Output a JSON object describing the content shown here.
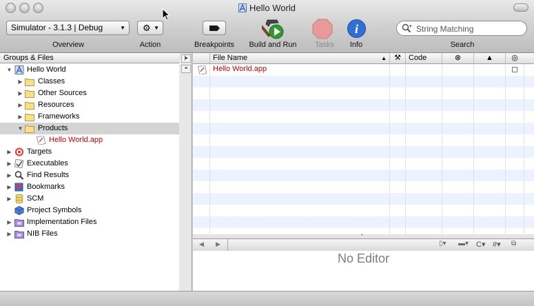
{
  "window": {
    "title": "Hello World",
    "accent_red": "#d00000"
  },
  "toolbar": {
    "scheme_value": "Simulator - 3.1.3 | Debug",
    "action_icon": "gear-icon",
    "labels": {
      "overview": "Overview",
      "action": "Action",
      "breakpoints": "Breakpoints",
      "build_and_run": "Build and Run",
      "tasks": "Tasks",
      "info": "Info",
      "search": "Search"
    },
    "search_placeholder": "String Matching"
  },
  "sidebar": {
    "header": "Groups & Files",
    "items": [
      {
        "label": "Hello World",
        "icon": "project-icon",
        "disclosure": "expanded"
      },
      {
        "label": "Classes",
        "icon": "folder-icon",
        "disclosure": "collapsed"
      },
      {
        "label": "Other Sources",
        "icon": "folder-icon",
        "disclosure": "collapsed"
      },
      {
        "label": "Resources",
        "icon": "folder-icon",
        "disclosure": "collapsed"
      },
      {
        "label": "Frameworks",
        "icon": "folder-icon",
        "disclosure": "collapsed"
      },
      {
        "label": "Products",
        "icon": "folder-icon",
        "disclosure": "expanded",
        "selected": true
      },
      {
        "label": "Hello World.app",
        "icon": "app-bundle-icon",
        "disclosure": "none",
        "missing": true
      },
      {
        "label": "Targets",
        "icon": "target-icon",
        "disclosure": "collapsed"
      },
      {
        "label": "Executables",
        "icon": "executable-icon",
        "disclosure": "collapsed"
      },
      {
        "label": "Find Results",
        "icon": "magnifier-icon",
        "disclosure": "collapsed"
      },
      {
        "label": "Bookmarks",
        "icon": "bookmark-icon",
        "disclosure": "collapsed"
      },
      {
        "label": "SCM",
        "icon": "scm-icon",
        "disclosure": "collapsed"
      },
      {
        "label": "Project Symbols",
        "icon": "symbols-cube-icon",
        "disclosure": "none"
      },
      {
        "label": "Implementation Files",
        "icon": "smart-group-icon",
        "disclosure": "collapsed"
      },
      {
        "label": "NIB Files",
        "icon": "smart-group-icon",
        "disclosure": "collapsed"
      }
    ]
  },
  "detail": {
    "columns": [
      "File Name",
      "Code"
    ],
    "column_icons": [
      "build-hammer-icon",
      "errors-icon",
      "warnings-icon",
      "target-membership-icon"
    ],
    "rows": [
      {
        "file_name": "Hello World.app",
        "missing": true
      }
    ]
  },
  "editor": {
    "empty_text": "No Editor",
    "nav_back": "◀",
    "nav_forward": "▶",
    "symbol_menu": "C",
    "include_menu": "#"
  }
}
